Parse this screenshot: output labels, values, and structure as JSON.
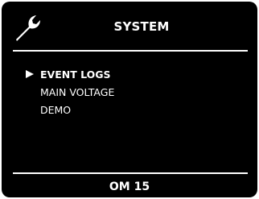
{
  "header": {
    "icon": "wrench-icon",
    "title": "SYSTEM"
  },
  "menu": {
    "selected_index": 0,
    "items": [
      {
        "label": "EVENT LOGS"
      },
      {
        "label": "MAIN VOLTAGE"
      },
      {
        "label": "DEMO"
      }
    ]
  },
  "footer": {
    "label": "OM 15"
  },
  "colors": {
    "background": "#000000",
    "foreground": "#ffffff"
  }
}
